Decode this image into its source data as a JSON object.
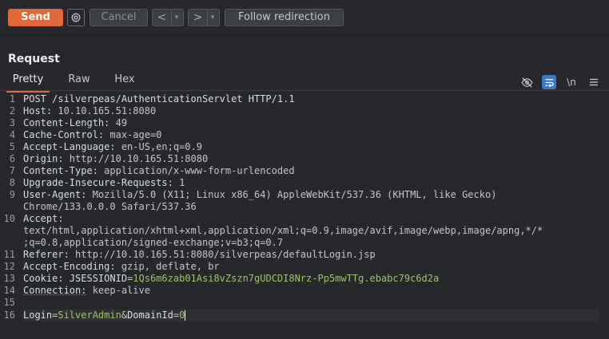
{
  "toolbar": {
    "send_label": "Send",
    "cancel_label": "Cancel",
    "back_label": "<",
    "forward_label": ">",
    "dropdown_glyph": "▾",
    "follow_label": "Follow redirection",
    "icons": [
      "gear-icon",
      "chevron-left-icon",
      "chevron-right-icon",
      "chevron-down-icon"
    ],
    "accent": "#e0683a"
  },
  "request": {
    "title": "Request",
    "tabs": [
      {
        "label": "Pretty",
        "active": true
      },
      {
        "label": "Raw",
        "active": false
      },
      {
        "label": "Hex",
        "active": false
      }
    ],
    "tools": {
      "hide_icon": "eye-off-icon",
      "wrap_icon": "word-wrap-icon",
      "newline_label": "\\n",
      "menu_icon": "menu-icon"
    }
  },
  "editor": {
    "lines": [
      {
        "n": "1",
        "key": "POST /silverpeas/AuthenticationServlet HTTP/1.1"
      },
      {
        "n": "2",
        "key": "Host:",
        "value": " 10.10.165.51:8080"
      },
      {
        "n": "3",
        "key": "Content-Length:",
        "value": " 49"
      },
      {
        "n": "4",
        "key": "Cache-Control:",
        "value": " max-age=0"
      },
      {
        "n": "5",
        "key": "Accept-Language:",
        "value": " en-US,en;q=0.9"
      },
      {
        "n": "6",
        "key": "Origin:",
        "value": " http://10.10.165.51:8080"
      },
      {
        "n": "7",
        "key": "Content-Type:",
        "value": " application/x-www-form-urlencoded"
      },
      {
        "n": "8",
        "key": "Upgrade-Insecure-Requests:",
        "value": " 1"
      },
      {
        "n": "9",
        "key": "User-Agent:",
        "value": " Mozilla/5.0 (X11; Linux x86_64) AppleWebKit/537.36 (KHTML, like Gecko)",
        "cont": "Chrome/133.0.0.0 Safari/537.36"
      },
      {
        "n": "10",
        "key": "Accept:",
        "cont1": "text/html,application/xhtml+xml,application/xml;q=0.9,image/avif,image/webp,image/apng,*/*",
        "cont2": ";q=0.8,application/signed-exchange;v=b3;q=0.7"
      },
      {
        "n": "11",
        "key": "Referer:",
        "value": " http://10.10.165.51:8080/silverpeas/defaultLogin.jsp"
      },
      {
        "n": "12",
        "key": "Accept-Encoding:",
        "value": " gzip, deflate, br"
      },
      {
        "n": "13",
        "key": "Cookie:",
        "cookie_name": " JSESSIONID",
        "eq": "=",
        "cookie_value": "1Qs6m6zab01Asi8vZszn7gUDCDI8Nrz-Pp5mwTTg.ebabc79c6d2a"
      },
      {
        "n": "14",
        "key": "Connection:",
        "value": " keep-alive"
      },
      {
        "n": "15"
      },
      {
        "n": "16",
        "p1": "Login",
        "e1": "=",
        "v1": "SilverAdmin",
        "amp": "&",
        "p2": "DomainId",
        "e2": "=",
        "v2": "0"
      }
    ]
  }
}
